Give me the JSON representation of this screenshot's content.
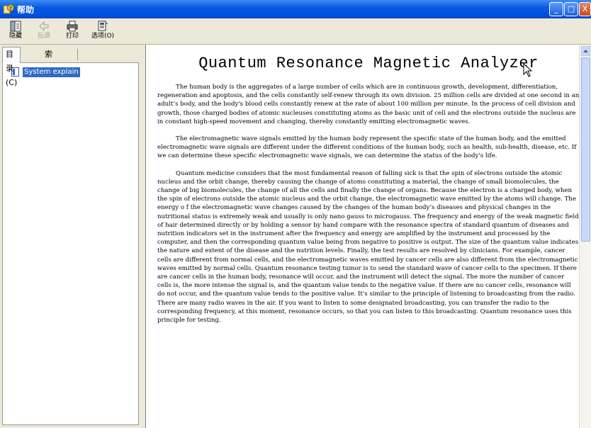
{
  "window": {
    "title": "帮助"
  },
  "window_controls": {
    "minimize": "_",
    "maximize": "□",
    "close": "X"
  },
  "toolbar": {
    "hide_label": "隐藏",
    "back_label": "后退",
    "print_label": "打印",
    "options_label": "选项(O)"
  },
  "nav": {
    "tab_contents": "目录(C)",
    "tab_index": "索引(N)",
    "items": [
      {
        "label": "System explain"
      }
    ]
  },
  "document": {
    "title": "Quantum Resonance Magnetic Analyzer",
    "paragraphs": [
      "The human body is the aggregates of a large number of cells which are in continuous growth, development, differentiation, regeneration and apoptosis, and the cells constantly self-renew through its own division. 25 million cells are divided at one second in an adult’s body, and the body's blood cells constantly renew at the rate of about 100 million per minute. In the process of cell division and growth, those charged bodies of atomic nucleuses constituting atoms as the basic unit of cell and the electrons outside the nucleus are in constant high-speed movement and changing, thereby constantly emitting electromagnetic waves.",
      "The electromagnetic wave signals emitted by the human body represent the specific state of the human body, and the emitted electromagnetic wave signals are different under the different conditions of the human body, such as health, sub-health, disease, etc. If we can determine these specific electromagnetic wave signals, we can determine the status of the body's life.",
      "Quantum medicine considers that the most fundamental reason of falling sick is that the spin of electrons outside the atomic nucleus and the orbit change, thereby causing the change of atoms constituting a material, the change of small biomolecules, the change of big biomolecules, the change of all the cells and finally the change of organs. Because the electron is a charged body, when the spin of electrons outside the atomic nucleus and the orbit change, the electromagnetic wave emitted by the atoms will change. The energy o f the electromagnetic wave changes caused by the changes of the human body’s diseases and physical changes in the nutritional status is extremely weak and usually is only nano gauss to microgauss. The frequency and energy of the weak magnetic field of hair determined directly or by holding a sensor by hand compare with the resonance spectra of standard quantum of diseases and nutrition indicators set in the instrument after the frequency and energy are amplified by the instrument and processed by the computer, and then the corresponding quantum value being from negative to positive is output. The size of the quantum value indicates the nature and extent of the disease and the nutrition levels. Finally, the test results are resolved by clinicians. For example, cancer cells are different from normal cells, and the electromagnetic waves emitted by cancer cells are also different from the electromagnetic waves emitted by normal cells. Quantum resonance testing tumor is to send the standard wave of cancer cells to the specimen. If there are cancer cells in the human body, resonance will occur, and the instrument will detect the signal. The more the number of cancer cells is, the more intense the signal is, and the quantum value tends to the negative value. If there are no cancer cells, resonance will do not occur, and the quantum value tends to the positive value. It's similar to the principle of listening to broadcasting from the radio. There are many radio waves in the air. If you want to listen to some designated broadcasting, you can transfer the radio to the corresponding frequency, at this moment, resonance occurs, so that you can listen to this broadcasting. Quantum resonance uses this principle for testing."
    ]
  },
  "icons": [
    "help-app-icon",
    "hide-icon",
    "back-icon",
    "print-icon",
    "options-icon",
    "page-icon",
    "scroll-up-arrow-icon",
    "mouse-cursor-icon"
  ],
  "colors": {
    "titlebar": "#0054e3",
    "selection": "#316ac5",
    "chrome": "#ece9d8"
  }
}
